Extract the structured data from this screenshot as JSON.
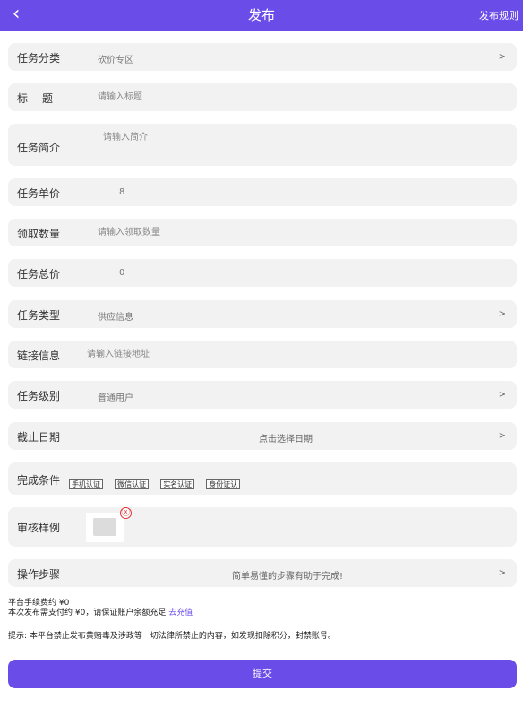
{
  "header": {
    "back_icon": "‹",
    "title": "发布",
    "rules_link": "发布规则"
  },
  "form": {
    "category": {
      "label": "任务分类",
      "value": "砍价专区",
      "arrow": ">"
    },
    "title": {
      "label": "标　题",
      "placeholder": "请输入标题"
    },
    "intro": {
      "label": "任务简介",
      "placeholder": "请输入简介"
    },
    "unit_price": {
      "label": "任务单价",
      "value": "8"
    },
    "quantity": {
      "label": "领取数量",
      "placeholder": "请输入领取数量"
    },
    "total_price": {
      "label": "任务总价",
      "value": "0"
    },
    "task_type": {
      "label": "任务类型",
      "value": "供应信息",
      "arrow": ">"
    },
    "link": {
      "label": "链接信息",
      "placeholder": "请输入链接地址"
    },
    "level": {
      "label": "任务级别",
      "value": "普通用户",
      "arrow": ">"
    },
    "deadline": {
      "label": "截止日期",
      "value": "点击选择日期",
      "arrow": ">"
    },
    "conditions": {
      "label": "完成条件",
      "tags": [
        "手机认证",
        "微信认证",
        "实名认证",
        "身份证认"
      ]
    },
    "sample": {
      "label": "审核样例",
      "close_icon": "ⓧ"
    },
    "steps": {
      "label": "操作步骤",
      "value": "简单易懂的步骤有助于完成!",
      "arrow": ">"
    }
  },
  "footer": {
    "fee_line": "平台手续费约 ¥0",
    "payment_line": "本次发布需支付约 ¥0，请保证账户余额充足",
    "recharge_link": "去充值",
    "notice": "提示: 本平台禁止发布黄赌毒及涉政等一切法律所禁止的内容，如发现扣除积分，封禁账号。",
    "submit_label": "提交"
  },
  "colors": {
    "accent": "#6a4ce8",
    "row_bg": "#f2f2f2",
    "close_red": "#dd3333"
  }
}
